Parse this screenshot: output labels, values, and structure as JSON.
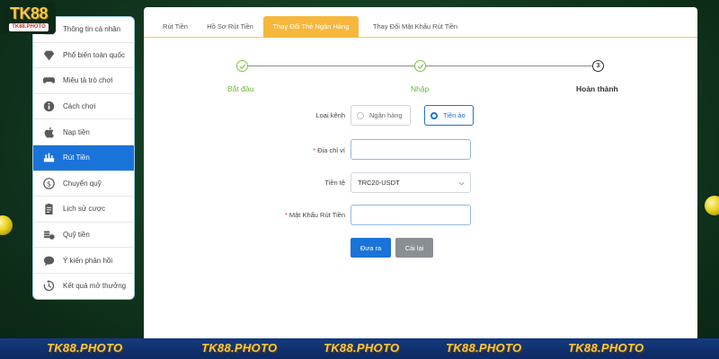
{
  "logo": {
    "main": "TK88",
    "sub": "TK88.PHOTO"
  },
  "sidebar": {
    "items": [
      {
        "label": "Thông tin cá nhân",
        "icon": "user-icon"
      },
      {
        "label": "Phổ biến toàn quốc",
        "icon": "diamond-icon"
      },
      {
        "label": "Miêu tả trò chơi",
        "icon": "gamepad-icon"
      },
      {
        "label": "Cách chơi",
        "icon": "info-icon"
      },
      {
        "label": "Nạp tiền",
        "icon": "apple-icon"
      },
      {
        "label": "Rút Tiền",
        "icon": "withdraw-icon",
        "active": true
      },
      {
        "label": "Chuyển quỹ",
        "icon": "dollar-icon"
      },
      {
        "label": "Lịch sử cược",
        "icon": "clipboard-icon"
      },
      {
        "label": "Quỹ tiền",
        "icon": "coins-icon"
      },
      {
        "label": "Ý kiến phản hồi",
        "icon": "chat-icon"
      },
      {
        "label": "Kết quả mở thưởng",
        "icon": "history-icon"
      }
    ]
  },
  "tabs": [
    {
      "label": "Rút Tiền"
    },
    {
      "label": "Hồ Sơ Rút Tiền"
    },
    {
      "label": "Thay Đổi Thẻ Ngân Hàng",
      "active": true
    },
    {
      "label": "Thay Đổi Mật Khẩu Rút Tiền"
    }
  ],
  "stepper": {
    "steps": [
      {
        "label": "Bắt đầu",
        "state": "done"
      },
      {
        "label": "Nhập",
        "state": "done"
      },
      {
        "label": "Hoàn thành",
        "state": "todo",
        "number": "3"
      }
    ]
  },
  "form": {
    "channel": {
      "label": "Loại kênh",
      "options": [
        {
          "label": "Ngân hàng",
          "checked": false
        },
        {
          "label": "Tiền ảo",
          "checked": true
        }
      ]
    },
    "wallet": {
      "required": "*",
      "label": "Địa chỉ ví",
      "value": ""
    },
    "currency": {
      "label": "Tiền tệ",
      "value": "TRC20-USDT"
    },
    "password": {
      "required": "*",
      "label": "Mật Khẩu Rút Tiền",
      "value": ""
    },
    "submit_label": "Đưa ra",
    "reset_label": "Cài lại"
  },
  "banner": {
    "items": [
      "TK88.PHOTO",
      "TK88.PHOTO",
      "TK88.PHOTO",
      "TK88.PHOTO",
      "TK88.PHOTO"
    ]
  },
  "colors": {
    "accent": "#1a73d9",
    "tab_active": "#f6b73c",
    "step_done": "#6fb33a",
    "banner": "#0d2a62",
    "gold": "#f5c84a"
  }
}
